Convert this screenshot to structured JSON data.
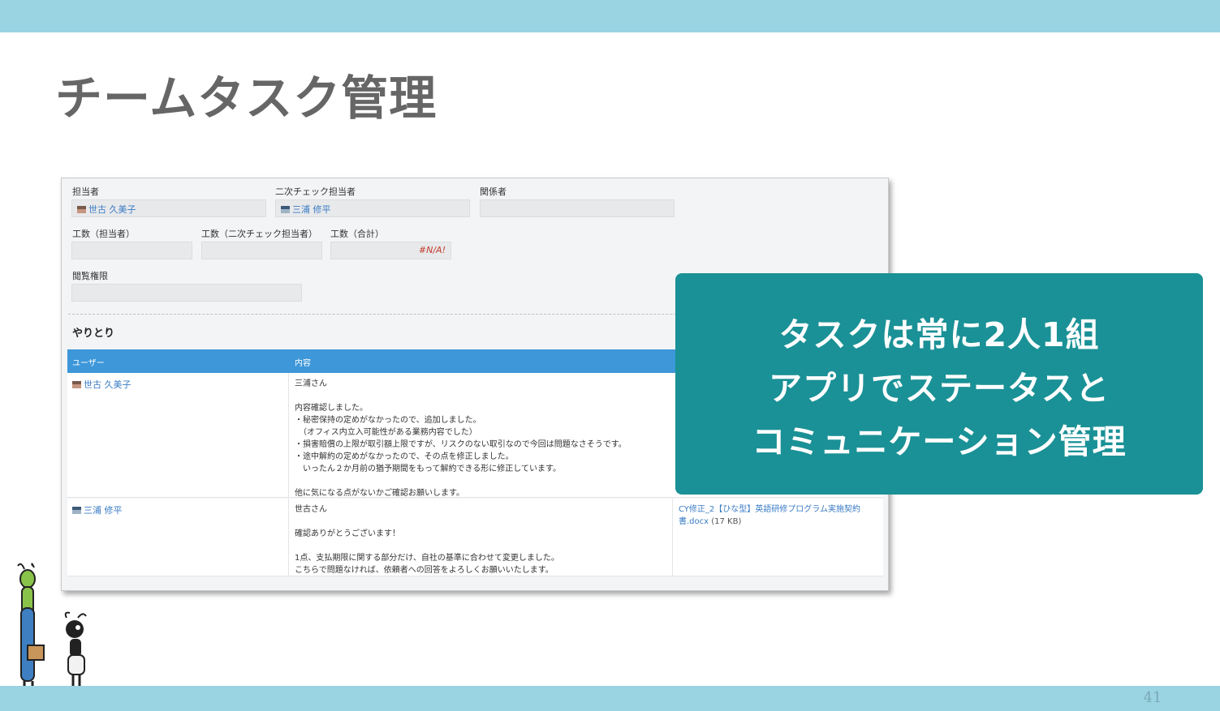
{
  "slide": {
    "title": "チームタスク管理",
    "page_number": "41"
  },
  "form": {
    "assignee_label": "担当者",
    "assignee_value": "世古 久美子",
    "second_check_label": "二次チェック担当者",
    "second_check_value": "三浦 修平",
    "related_label": "関係者",
    "related_value": "",
    "effort_assignee_label": "工数（担当者）",
    "effort_second_label": "工数（二次チェック担当者）",
    "effort_total_label": "工数（合計）",
    "effort_total_value": "#N/A!",
    "permission_label": "閲覧権限"
  },
  "exchange": {
    "section_title": "やりとり",
    "col_user": "ユーザー",
    "col_content": "内容",
    "rows": [
      {
        "user": "世古 久美子",
        "body": "三浦さん\n\n内容確認しました。\n・秘密保持の定めがなかったので、追加しました。\n　（オフィス内立入可能性がある業務内容でした）\n・損害賠償の上限が取引額上限ですが、リスクのない取引なので今回は問題なさそうです。\n・途中解約の定めがなかったので、その点を修正しました。\n　いったん２か月前の猶予期間をもって解約できる形に修正しています。\n\n他に気になる点がないかご確認お願いします。"
      },
      {
        "user": "三浦 修平",
        "body": "世古さん\n\n確認ありがとうございます！\n\n1点、支払期限に関する部分だけ、自社の基準に合わせて変更しました。\nこちらで問題なければ、依頼者への回答をよろしくお願いいたします。",
        "attachment_name": "CY修正_2【ひな型】英語研修プログラム実施契約書.docx",
        "attachment_size": "(17 KB)"
      }
    ]
  },
  "callout": {
    "line1": "タスクは常に2人1組",
    "line2": "アプリでステータスと",
    "line3": "コミュニケーション管理"
  },
  "colors": {
    "band": "#9ad4e3",
    "callout": "#1a9196",
    "table_header": "#3d97d9",
    "link": "#3a7cc4"
  }
}
